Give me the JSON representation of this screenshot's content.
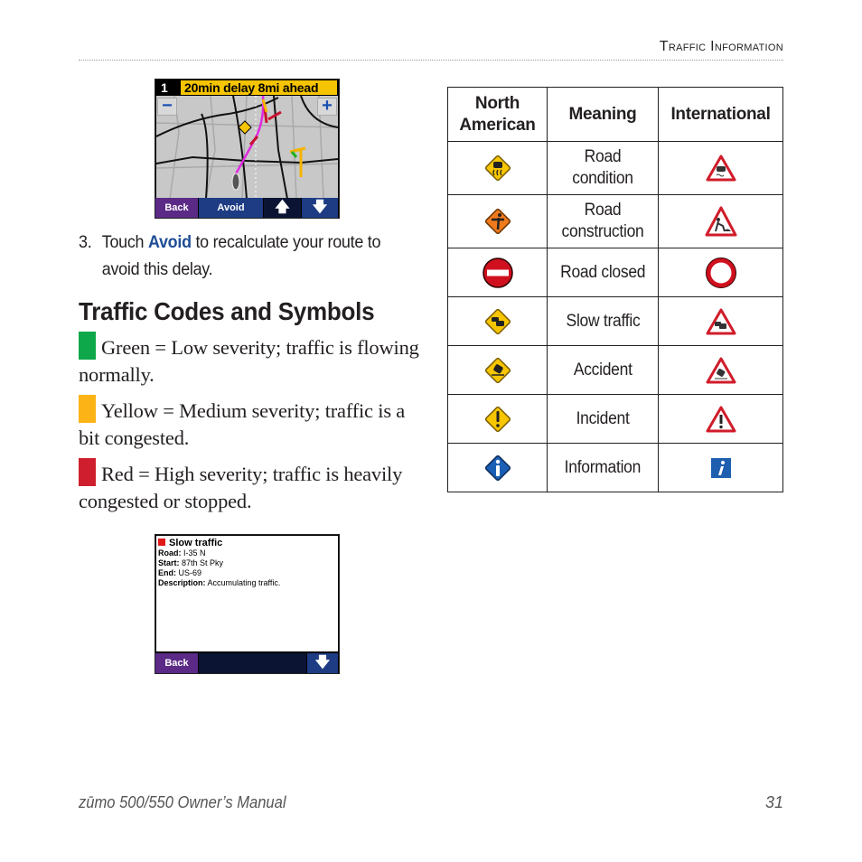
{
  "header": {
    "running_head": "Traffic Information"
  },
  "map_screen": {
    "banner_number": "1",
    "banner_message": "20min delay 8mi ahead",
    "zoom_out_label": "−",
    "zoom_in_label": "+",
    "buttons": {
      "back": "Back",
      "avoid": "Avoid",
      "up": "🡅",
      "down": "🡇"
    }
  },
  "step3": {
    "number": "3.",
    "text_before": "Touch ",
    "keyword": "Avoid",
    "text_after": " to recalculate your route to avoid this delay."
  },
  "section_title": "Traffic Codes and Symbols",
  "severity": [
    {
      "color": "#0ea84a",
      "text": "Green = Low severity; traffic is flowing normally."
    },
    {
      "color": "#fbb316",
      "text": "Yellow = Medium severity; traffic is a bit congested."
    },
    {
      "color": "#cf1f2e",
      "text": "Red = High severity; traffic is heavily congested or stopped."
    }
  ],
  "detail_screen": {
    "title": "Slow traffic",
    "title_color": "#e01818",
    "fields": [
      {
        "label": "Road:",
        "value": "I-35 N"
      },
      {
        "label": "Start:",
        "value": "87th St Pky"
      },
      {
        "label": "End:",
        "value": "US-69"
      },
      {
        "label": "Description:",
        "value": "Accumulating traffic."
      }
    ],
    "buttons": {
      "back": "Back",
      "up": "🡅",
      "down": "🡇"
    }
  },
  "table": {
    "headers": [
      "North American",
      "Meaning",
      "International"
    ],
    "rows": [
      {
        "na_icon": "road-condition-diamond-icon",
        "meaning": "Road condition",
        "intl_icon": "road-condition-triangle-icon"
      },
      {
        "na_icon": "road-construction-diamond-icon",
        "meaning": "Road construction",
        "intl_icon": "road-construction-triangle-icon"
      },
      {
        "na_icon": "road-closed-circle-icon",
        "meaning": "Road closed",
        "intl_icon": "road-closed-ring-icon"
      },
      {
        "na_icon": "slow-traffic-diamond-icon",
        "meaning": "Slow traffic",
        "intl_icon": "slow-traffic-triangle-icon"
      },
      {
        "na_icon": "accident-diamond-icon",
        "meaning": "Accident",
        "intl_icon": "accident-triangle-icon"
      },
      {
        "na_icon": "incident-diamond-icon",
        "meaning": "Incident",
        "intl_icon": "incident-triangle-icon"
      },
      {
        "na_icon": "information-diamond-icon",
        "meaning": "Information",
        "intl_icon": "information-square-icon"
      }
    ]
  },
  "footer": {
    "title": "zūmo 500/550 Owner’s Manual",
    "page_number": "31"
  }
}
